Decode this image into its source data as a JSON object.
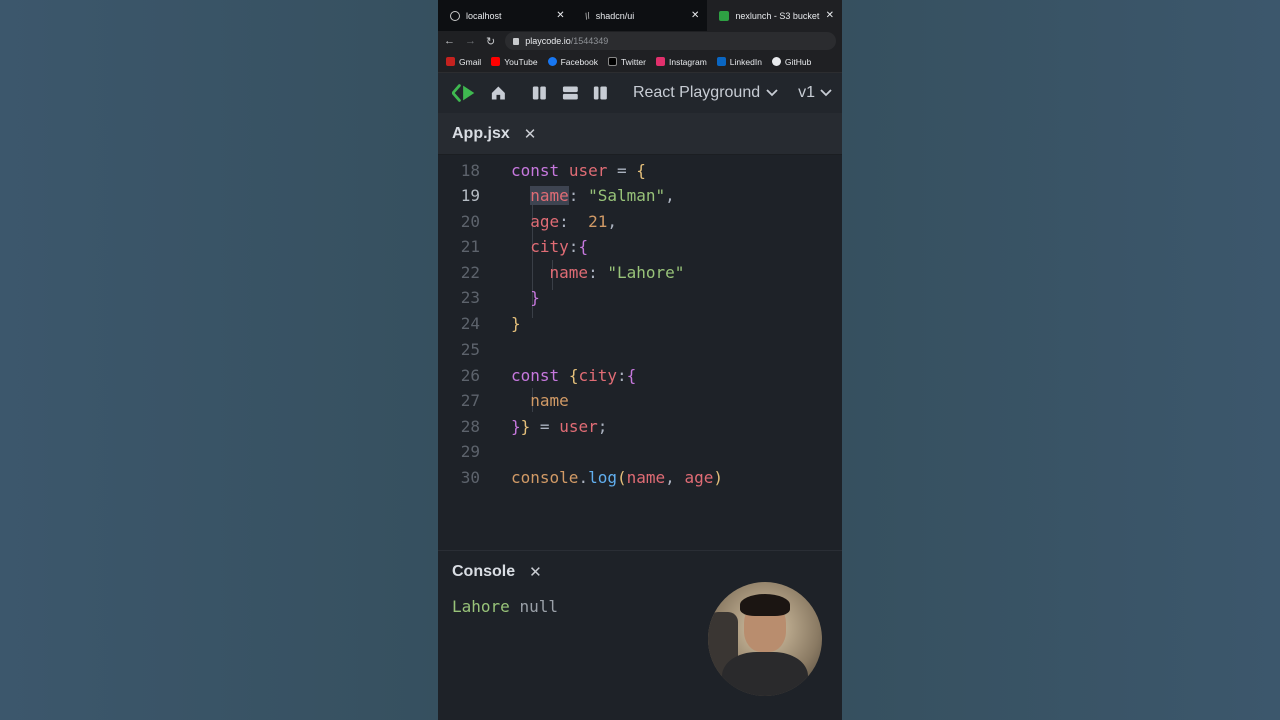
{
  "browser": {
    "tabs": [
      {
        "label": "localhost",
        "icon": "globe-icon",
        "active": false
      },
      {
        "label": "shadcn/ui",
        "icon": "shadcn-icon",
        "active": false
      },
      {
        "label": "nexlunch - S3 bucket",
        "icon": "s3-icon",
        "active": true
      }
    ],
    "tab_close": "✕",
    "url_domain": "playcode.io",
    "url_path": "/1544349",
    "bookmarks": [
      {
        "label": "Gmail",
        "color": "#e8eaed"
      },
      {
        "label": "YouTube",
        "color": "#ff0000"
      },
      {
        "label": "Facebook",
        "color": "#1877f2"
      },
      {
        "label": "Twitter",
        "color": "#e8eaed"
      },
      {
        "label": "Instagram",
        "color": "#e1306c"
      },
      {
        "label": "LinkedIn",
        "color": "#0a66c2"
      },
      {
        "label": "GitHub",
        "color": "#e8eaed"
      }
    ]
  },
  "app": {
    "project_name": "React Playground",
    "version": "v1",
    "file_tab": "App.jsx",
    "console_title": "Console",
    "close_glyph": "✕"
  },
  "editor": {
    "line_numbers": [
      "18",
      "19",
      "20",
      "21",
      "22",
      "23",
      "24",
      "25",
      "26",
      "27",
      "28",
      "29",
      "30"
    ],
    "current_line": "19"
  },
  "console": {
    "output_value": "Lahore",
    "output_null": "null"
  },
  "colors": {
    "accent_green": "#2ea043",
    "keyword": "#c678dd",
    "string": "#98c379"
  }
}
